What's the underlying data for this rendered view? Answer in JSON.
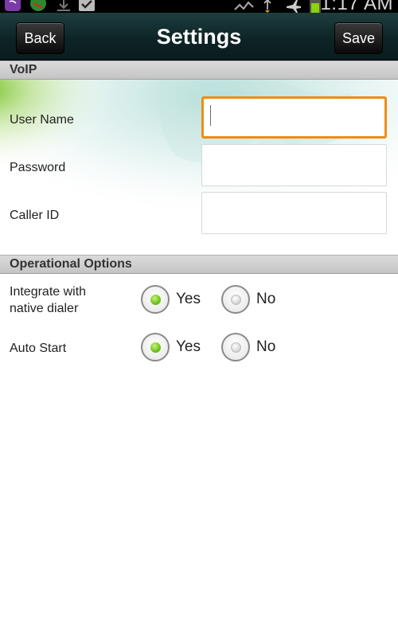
{
  "status_bar": {
    "time": "1:17 AM",
    "icons": [
      "viber-icon",
      "sync-icon",
      "download-icon",
      "checkbox-icon",
      "signal-icon",
      "usb-icon",
      "airplane-icon",
      "battery-icon"
    ]
  },
  "header": {
    "back_label": "Back",
    "title": "Settings",
    "save_label": "Save"
  },
  "voip": {
    "section_title": "VoIP",
    "fields": [
      {
        "label": "User Name",
        "value": "",
        "focused": true
      },
      {
        "label": "Password",
        "value": "",
        "focused": false
      },
      {
        "label": "Caller ID",
        "value": "",
        "focused": false
      }
    ]
  },
  "operational": {
    "section_title": "Operational Options",
    "options": [
      {
        "label_line1": "Integrate with",
        "label_line2": "native dialer",
        "yes": "Yes",
        "no": "No",
        "selected": "Yes"
      },
      {
        "label_line1": "Auto Start",
        "yes": "Yes",
        "no": "No",
        "selected": "Yes"
      }
    ]
  },
  "colors": {
    "focus_border": "#f08c13",
    "radio_selected": "#6cc21c",
    "header_bg": "#0d2426"
  }
}
